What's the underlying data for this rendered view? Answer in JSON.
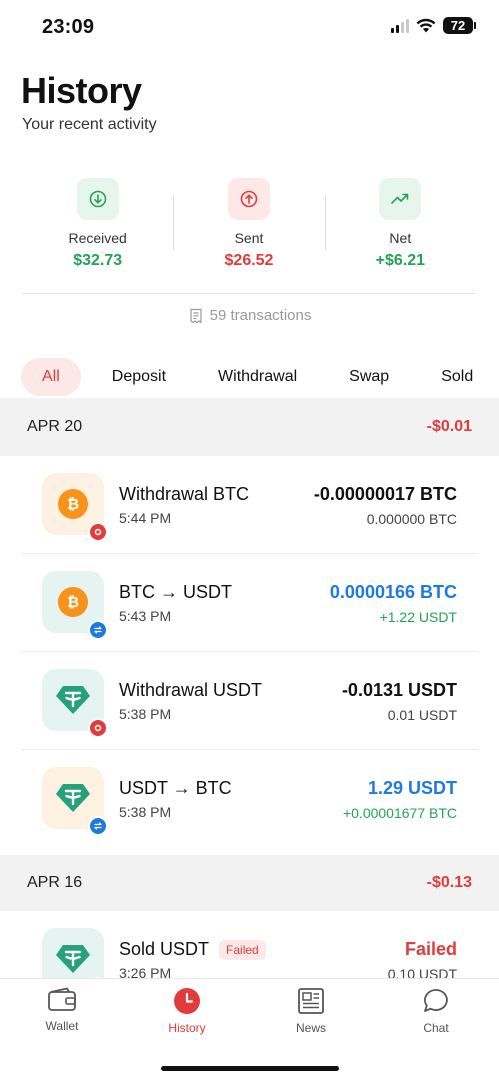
{
  "status_bar": {
    "time": "23:09",
    "battery": "72"
  },
  "header": {
    "title": "History",
    "subtitle": "Your recent activity"
  },
  "summary": {
    "received": {
      "label": "Received",
      "value": "$32.73",
      "icon": "arrow-down-circle-icon"
    },
    "sent": {
      "label": "Sent",
      "value": "$26.52",
      "icon": "arrow-up-circle-icon"
    },
    "net": {
      "label": "Net",
      "value": "+$6.21",
      "icon": "trending-up-icon"
    },
    "transactions": "59 transactions"
  },
  "tabs": [
    "All",
    "Deposit",
    "Withdrawal",
    "Swap",
    "Sold"
  ],
  "sections": [
    {
      "date": "APR 20",
      "total": "-$0.01",
      "items": [
        {
          "title": "Withdrawal BTC",
          "time": "5:44 PM",
          "amount": "-0.00000017 BTC",
          "sub": "0.000000 BTC"
        },
        {
          "title": "BTC → USDT",
          "time": "5:43 PM",
          "amount": "0.0000166 BTC",
          "sub": "+1.22 USDT"
        },
        {
          "title": "Withdrawal USDT",
          "time": "5:38 PM",
          "amount": "-0.0131 USDT",
          "sub": "0.01 USDT"
        },
        {
          "title": "USDT → BTC",
          "time": "5:38 PM",
          "amount": "1.29 USDT",
          "sub": "+0.00001677 BTC"
        }
      ]
    },
    {
      "date": "APR 16",
      "total": "-$0.13",
      "items": [
        {
          "title": "Sold USDT",
          "badge": "Failed",
          "time": "3:26 PM",
          "amount": "Failed",
          "sub": "0.10 USDT"
        }
      ]
    }
  ],
  "nav": {
    "wallet": "Wallet",
    "history": "History",
    "news": "News",
    "chat": "Chat"
  },
  "colors": {
    "accent": "#e23b3b",
    "positive": "#23a455",
    "swap": "#1f7ae0",
    "btc": "#f7931a",
    "usdt": "#26a17b"
  }
}
